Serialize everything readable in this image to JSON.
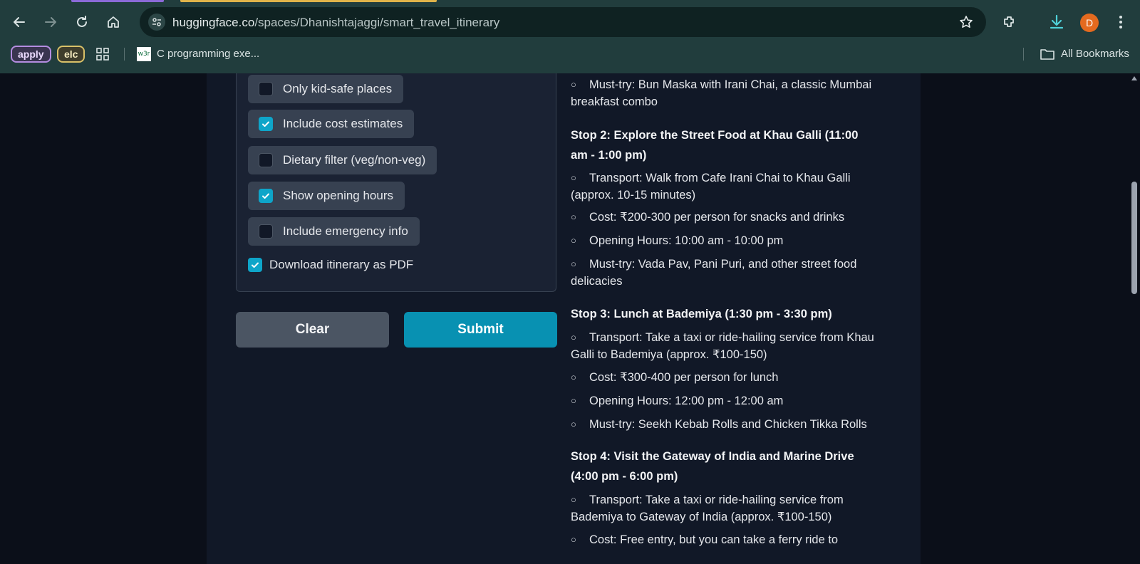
{
  "browser": {
    "url_host": "huggingface.co",
    "url_path": "/spaces/Dhanishtajaggi/smart_travel_itinerary",
    "avatar_letter": "D",
    "bookmarks": [
      {
        "label": "apply"
      },
      {
        "label": "elc"
      },
      {
        "label": "C programming exe..."
      }
    ],
    "all_bookmarks_label": "All Bookmarks",
    "favicon_text": "w3r"
  },
  "options": [
    {
      "label": "Only kid-safe places",
      "checked": false
    },
    {
      "label": "Include cost estimates",
      "checked": true
    },
    {
      "label": "Dietary filter (veg/non-veg)",
      "checked": false
    },
    {
      "label": "Show opening hours",
      "checked": true
    },
    {
      "label": "Include emergency info",
      "checked": false
    }
  ],
  "download_pdf": {
    "label": "Download itinerary as PDF",
    "checked": true
  },
  "buttons": {
    "clear": "Clear",
    "submit": "Submit"
  },
  "itinerary": {
    "bullet_glyph": "○",
    "lines": [
      {
        "kind": "bullet",
        "l1": "Must-try: Bun Maska with Irani Chai, a classic Mumbai",
        "l2": "breakfast combo"
      },
      {
        "kind": "heading",
        "l1": "Stop 2: Explore the Street Food at Khau Galli (11:00",
        "l2": "am - 1:00 pm)"
      },
      {
        "kind": "bullet",
        "l1": "Transport: Walk from Cafe Irani Chai to Khau Galli",
        "l2": "(approx. 10-15 minutes)"
      },
      {
        "kind": "bullet",
        "l1": "Cost: ₹200-300 per person for snacks and drinks",
        "l2": ""
      },
      {
        "kind": "bullet",
        "l1": "Opening Hours: 10:00 am - 10:00 pm",
        "l2": ""
      },
      {
        "kind": "bullet",
        "l1": "Must-try: Vada Pav, Pani Puri, and other street food",
        "l2": "delicacies"
      },
      {
        "kind": "heading",
        "l1": "Stop 3: Lunch at Bademiya (1:30 pm - 3:30 pm)",
        "l2": ""
      },
      {
        "kind": "bullet",
        "l1": "Transport: Take a taxi or ride-hailing service from Khau",
        "l2": "Galli to Bademiya (approx. ₹100-150)"
      },
      {
        "kind": "bullet",
        "l1": "Cost: ₹300-400 per person for lunch",
        "l2": ""
      },
      {
        "kind": "bullet",
        "l1": "Opening Hours: 12:00 pm - 12:00 am",
        "l2": ""
      },
      {
        "kind": "bullet",
        "l1": "Must-try: Seekh Kebab Rolls and Chicken Tikka Rolls",
        "l2": ""
      },
      {
        "kind": "heading",
        "l1": "Stop 4: Visit the Gateway of India and Marine Drive",
        "l2": "(4:00 pm - 6:00 pm)"
      },
      {
        "kind": "bullet",
        "l1": "Transport: Take a taxi or ride-hailing service from",
        "l2": "Bademiya to Gateway of India (approx. ₹100-150)"
      },
      {
        "kind": "bullet",
        "l1": "Cost: Free entry, but you can take a ferry ride to",
        "l2": ""
      }
    ]
  }
}
